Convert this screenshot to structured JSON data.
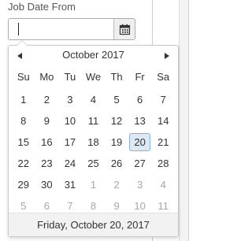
{
  "field": {
    "label": "Job Date From",
    "value": "",
    "placeholder": "",
    "calendar_icon": "calendar-icon"
  },
  "calendar": {
    "month_title": "October 2017",
    "prev_icon": "triangle-left-icon",
    "next_icon": "triangle-right-icon",
    "weekdays": [
      "Su",
      "Mo",
      "Tu",
      "We",
      "Th",
      "Fr",
      "Sa"
    ],
    "days": [
      {
        "label": "1",
        "other": false
      },
      {
        "label": "2",
        "other": false
      },
      {
        "label": "3",
        "other": false
      },
      {
        "label": "4",
        "other": false
      },
      {
        "label": "5",
        "other": false
      },
      {
        "label": "6",
        "other": false
      },
      {
        "label": "7",
        "other": false
      },
      {
        "label": "8",
        "other": false
      },
      {
        "label": "9",
        "other": false
      },
      {
        "label": "10",
        "other": false
      },
      {
        "label": "11",
        "other": false
      },
      {
        "label": "12",
        "other": false
      },
      {
        "label": "13",
        "other": false
      },
      {
        "label": "14",
        "other": false
      },
      {
        "label": "15",
        "other": false
      },
      {
        "label": "16",
        "other": false
      },
      {
        "label": "17",
        "other": false
      },
      {
        "label": "18",
        "other": false
      },
      {
        "label": "19",
        "other": false
      },
      {
        "label": "20",
        "other": false,
        "selected": true
      },
      {
        "label": "21",
        "other": false
      },
      {
        "label": "22",
        "other": false
      },
      {
        "label": "23",
        "other": false
      },
      {
        "label": "24",
        "other": false
      },
      {
        "label": "25",
        "other": false
      },
      {
        "label": "26",
        "other": false
      },
      {
        "label": "27",
        "other": false
      },
      {
        "label": "28",
        "other": false
      },
      {
        "label": "29",
        "other": false
      },
      {
        "label": "30",
        "other": false
      },
      {
        "label": "31",
        "other": false
      },
      {
        "label": "1",
        "other": true
      },
      {
        "label": "2",
        "other": true
      },
      {
        "label": "3",
        "other": true
      },
      {
        "label": "4",
        "other": true
      },
      {
        "label": "5",
        "other": true
      },
      {
        "label": "6",
        "other": true
      },
      {
        "label": "7",
        "other": true
      },
      {
        "label": "8",
        "other": true
      },
      {
        "label": "9",
        "other": true
      },
      {
        "label": "10",
        "other": true
      },
      {
        "label": "11",
        "other": true
      }
    ],
    "footer": "Friday, October 20, 2017"
  },
  "colors": {
    "selected_bg": "#dce8f4",
    "selected_border": "#8ab0d6",
    "other_month_text": "#a8a8a8",
    "footer_bg": "#f2f2f2"
  }
}
